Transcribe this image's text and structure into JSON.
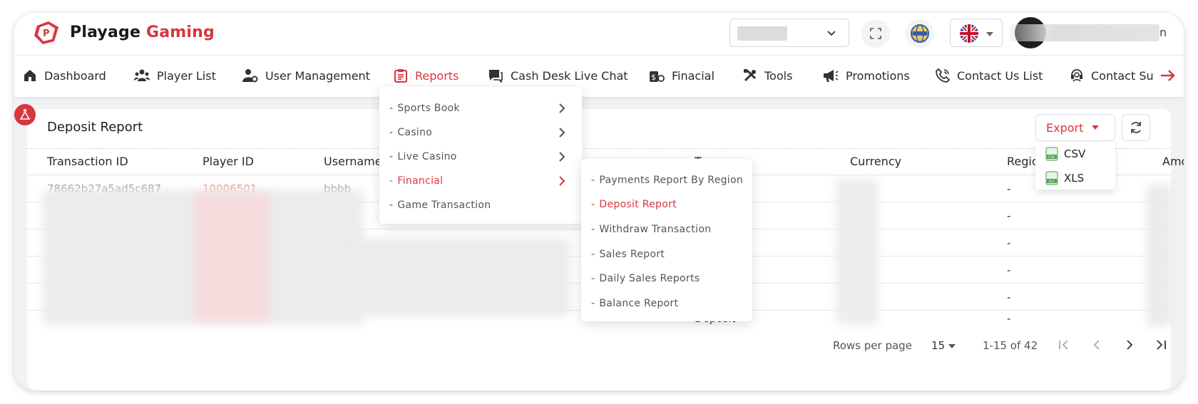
{
  "brand": {
    "name_part1": "Playage",
    "name_part2": "Gaming",
    "accent": "#d9363e"
  },
  "header": {
    "user_name_tail": "n"
  },
  "nav": {
    "items": [
      {
        "label": "Dashboard",
        "icon": "home-icon"
      },
      {
        "label": "Player List",
        "icon": "users-icon"
      },
      {
        "label": "User Management",
        "icon": "user-gear-icon"
      },
      {
        "label": "Reports",
        "icon": "clipboard-icon",
        "active": true
      },
      {
        "label": "Cash Desk Live Chat",
        "icon": "chat-icon"
      },
      {
        "label": "Finacial",
        "icon": "money-icon"
      },
      {
        "label": "Tools",
        "icon": "tools-icon"
      },
      {
        "label": "Promotions",
        "icon": "megaphone-icon"
      },
      {
        "label": "Contact Us List",
        "icon": "phone-icon"
      },
      {
        "label": "Contact Su",
        "icon": "support-icon"
      }
    ]
  },
  "reports_menu": {
    "items": [
      {
        "label": "Sports Book",
        "has_sub": true
      },
      {
        "label": "Casino",
        "has_sub": true
      },
      {
        "label": "Live Casino",
        "has_sub": true
      },
      {
        "label": "Financial",
        "has_sub": true,
        "active": true
      },
      {
        "label": "Game Transaction",
        "has_sub": false
      }
    ]
  },
  "financial_submenu": {
    "items": [
      {
        "label": "Payments Report By Region"
      },
      {
        "label": "Deposit Report",
        "active": true
      },
      {
        "label": "Withdraw Transaction"
      },
      {
        "label": "Sales Report"
      },
      {
        "label": "Daily Sales Reports"
      },
      {
        "label": "Balance Report"
      }
    ]
  },
  "page": {
    "title": "Deposit Report",
    "export_label": "Export",
    "export_options": [
      "CSV",
      "XLS"
    ]
  },
  "table": {
    "columns": [
      "Transaction ID",
      "Player ID",
      "Username",
      "T",
      "Currency",
      "Region",
      "Amo"
    ],
    "region_values": [
      "-",
      "-",
      "-",
      "-",
      "-",
      "-"
    ],
    "partial_row1": {
      "transaction_id": "78662b27a5ad5c687",
      "player_id": "10006501",
      "username": "bbbb"
    },
    "partial_last": {
      "type": "Deposit"
    }
  },
  "footer": {
    "rows_per_page_label": "Rows per page",
    "rows_per_page_value": "15",
    "range_text": "1-15 of 42"
  }
}
